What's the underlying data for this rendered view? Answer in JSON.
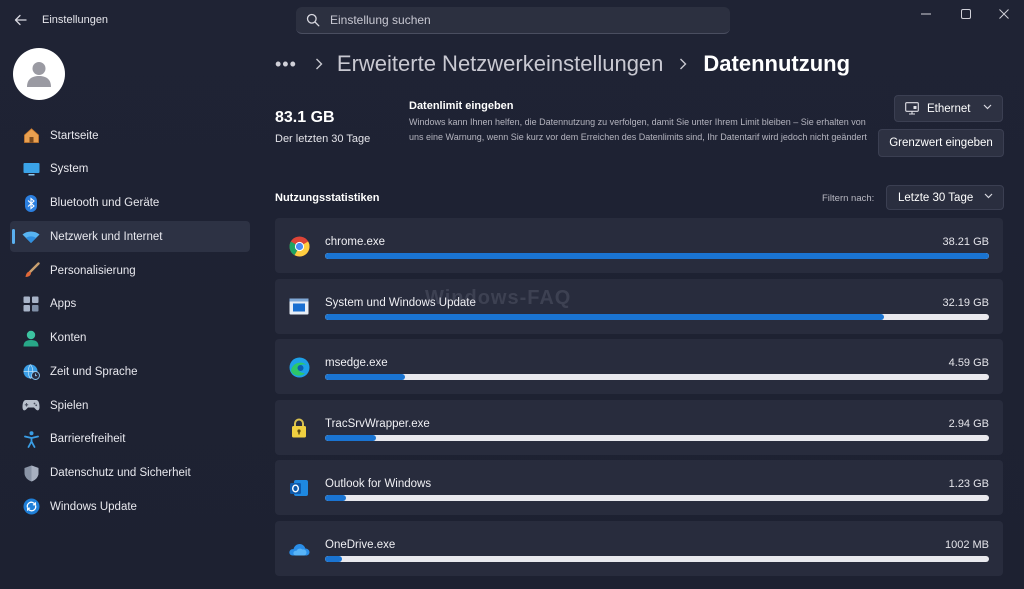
{
  "window": {
    "title": "Einstellungen",
    "search_placeholder": "Einstellung suchen"
  },
  "sidebar": {
    "items": [
      {
        "label": "Startseite",
        "icon": "home-icon",
        "active": false
      },
      {
        "label": "System",
        "icon": "system-icon",
        "active": false
      },
      {
        "label": "Bluetooth und Geräte",
        "icon": "bluetooth-icon",
        "active": false
      },
      {
        "label": "Netzwerk und Internet",
        "icon": "wifi-icon",
        "active": true
      },
      {
        "label": "Personalisierung",
        "icon": "brush-icon",
        "active": false
      },
      {
        "label": "Apps",
        "icon": "apps-icon",
        "active": false
      },
      {
        "label": "Konten",
        "icon": "account-icon",
        "active": false
      },
      {
        "label": "Zeit und Sprache",
        "icon": "globe-clock-icon",
        "active": false
      },
      {
        "label": "Spielen",
        "icon": "gamepad-icon",
        "active": false
      },
      {
        "label": "Barrierefreiheit",
        "icon": "accessibility-icon",
        "active": false
      },
      {
        "label": "Datenschutz und Sicherheit",
        "icon": "shield-icon",
        "active": false
      },
      {
        "label": "Windows Update",
        "icon": "update-icon",
        "active": false
      }
    ]
  },
  "breadcrumb": {
    "more": "•••",
    "parent": "Erweiterte Netzwerkeinstellungen",
    "current": "Datennutzung"
  },
  "summary": {
    "total": "83.1 GB",
    "period": "Der letzten 30 Tage"
  },
  "limit": {
    "title": "Datenlimit eingeben",
    "description": "Windows kann Ihnen helfen, die Datennutzung zu verfolgen, damit Sie unter Ihrem Limit bleiben – Sie erhalten von uns eine Warnung, wenn Sie kurz vor dem Erreichen des Datenlimits sind, Ihr Datentarif wird jedoch nicht geändert",
    "adapter": "Ethernet",
    "button": "Grenzwert eingeben"
  },
  "stats": {
    "title": "Nutzungsstatistiken",
    "filter_label": "Filtern nach:",
    "filter_value": "Letzte 30 Tage"
  },
  "usage": [
    {
      "name": "chrome.exe",
      "size": "38.21 GB",
      "fraction": 1.0,
      "icon": "chrome-icon"
    },
    {
      "name": "System und Windows Update",
      "size": "32.19 GB",
      "fraction": 0.842,
      "icon": "windows-system-icon"
    },
    {
      "name": "msedge.exe",
      "size": "4.59 GB",
      "fraction": 0.12,
      "icon": "edge-icon"
    },
    {
      "name": "TracSrvWrapper.exe",
      "size": "2.94 GB",
      "fraction": 0.077,
      "icon": "lock-icon"
    },
    {
      "name": "Outlook for Windows",
      "size": "1.23 GB",
      "fraction": 0.032,
      "icon": "outlook-icon"
    },
    {
      "name": "OneDrive.exe",
      "size": "1002 MB",
      "fraction": 0.026,
      "icon": "onedrive-icon"
    }
  ],
  "watermark": "Windows-FAQ",
  "colors": {
    "accent": "#1a74d2",
    "active_indicator": "#5ab0f0",
    "background": "#1d2131",
    "card": "#282c3d"
  }
}
